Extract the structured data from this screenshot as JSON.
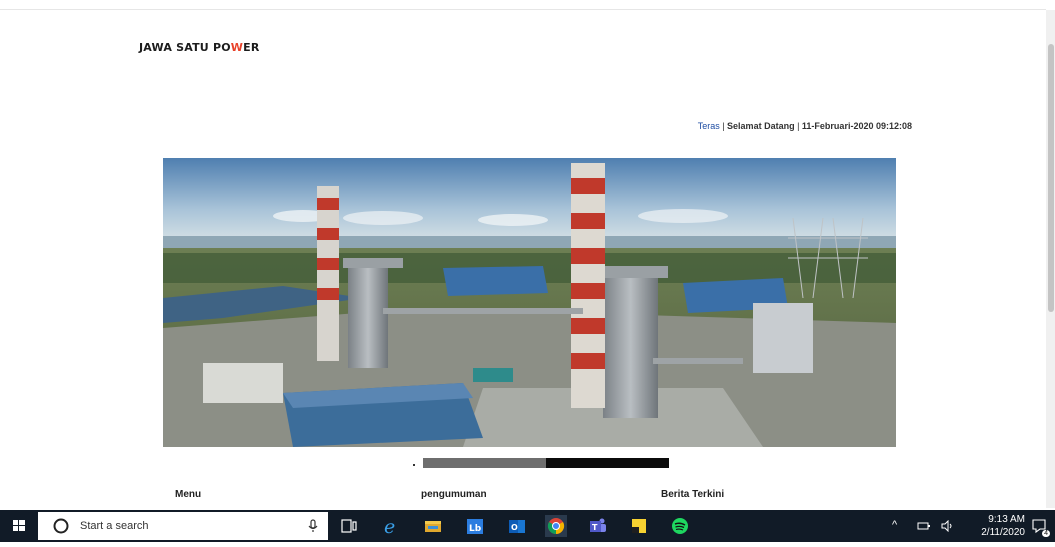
{
  "header": {
    "logo_text_left": "JAWA SATU PO",
    "logo_slash": "W",
    "logo_text_right": "ER"
  },
  "topnav": {
    "home_link": "Teras",
    "separator": " | ",
    "greeting": "Selamat Datang",
    "datetime": "11-Februari-2020 09:12:08"
  },
  "sections": {
    "menu": "Menu",
    "announcements": "pengumuman",
    "news": "Berita Terkini"
  },
  "taskbar": {
    "search_placeholder": "Start a search",
    "time": "9:13 AM",
    "date": "2/11/2020",
    "notification_count": "4",
    "apps": [
      "windows-icon",
      "mic-icon",
      "task-view-icon",
      "edge-icon",
      "file-explorer-icon",
      "linkedin-learning-icon",
      "outlook-icon",
      "chrome-icon",
      "teams-icon",
      "sticky-notes-icon",
      "spotify-icon"
    ]
  },
  "colors": {
    "link": "#1f4ea3",
    "taskbar_bg": "#111b27",
    "logo_accent": "#e8422a"
  }
}
